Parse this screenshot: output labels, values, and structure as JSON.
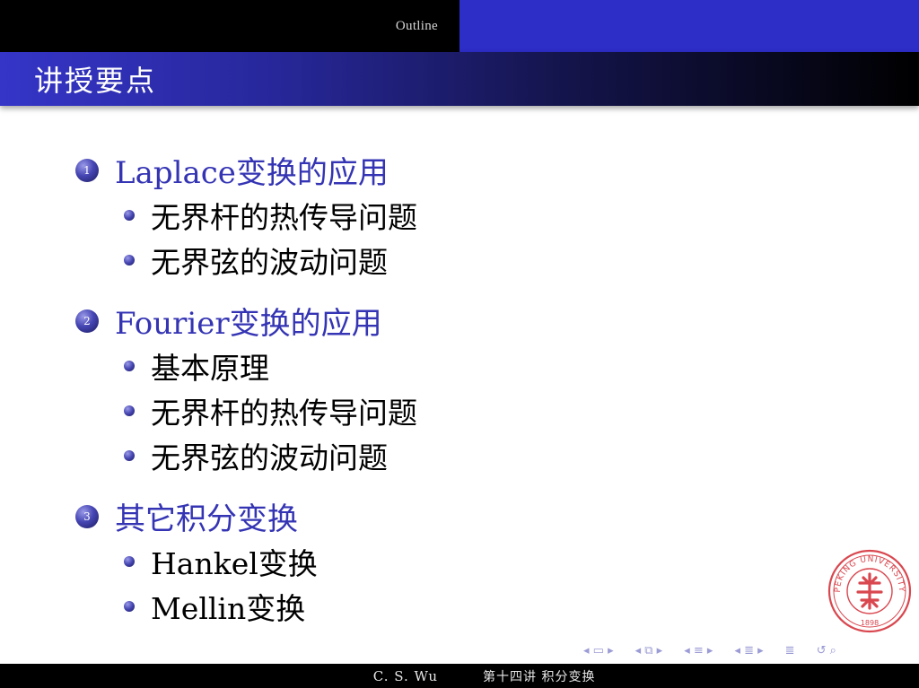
{
  "header": {
    "section": "Outline",
    "frame_title": "讲授要点"
  },
  "outline": {
    "sections": [
      {
        "number": "1",
        "title": "Laplace变换的应用",
        "items": [
          "无界杆的热传导问题",
          "无界弦的波动问题"
        ]
      },
      {
        "number": "2",
        "title": "Fourier变换的应用",
        "items": [
          "基本原理",
          "无界杆的热传导问题",
          "无界弦的波动问题"
        ]
      },
      {
        "number": "3",
        "title": "其它积分变换",
        "items": [
          "Hankel变换",
          "Mellin变换"
        ]
      }
    ]
  },
  "seal": {
    "text": "PEKING UNIVERSITY",
    "year": "1898",
    "color": "#d9474f"
  },
  "navigation": {
    "icons": [
      "frame-nav-icon",
      "subsection-nav-icon",
      "section-nav-icon",
      "subsection-nav-icon",
      "align-icon",
      "search-icon"
    ]
  },
  "footer": {
    "author": "C. S. Wu",
    "lecture": "第十四讲  积分变换"
  },
  "colors": {
    "accent": "#3434b4",
    "title_bar_start": "#3535c8",
    "header_right": "#2d2dc8",
    "nav": "#9b9bd6"
  }
}
